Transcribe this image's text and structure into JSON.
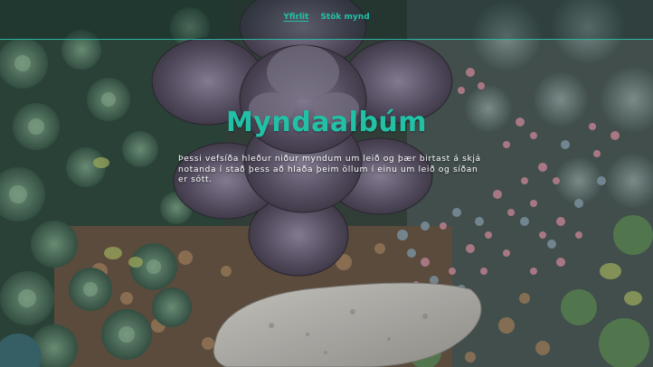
{
  "nav": {
    "items": [
      {
        "label": "Yfirlit",
        "active": true
      },
      {
        "label": "Stök mynd",
        "active": false
      }
    ],
    "accent_color": "#22c1a6"
  },
  "hero": {
    "title": "Myndaalbúm",
    "description": "Þessi vefsíða hleður niður myndum um leið og þær birtast á skjá notanda í stað þess að hlaða þeim öllum í einu um leið og síðan er sótt."
  },
  "background": {
    "subject": "succulent-plants-photo"
  }
}
